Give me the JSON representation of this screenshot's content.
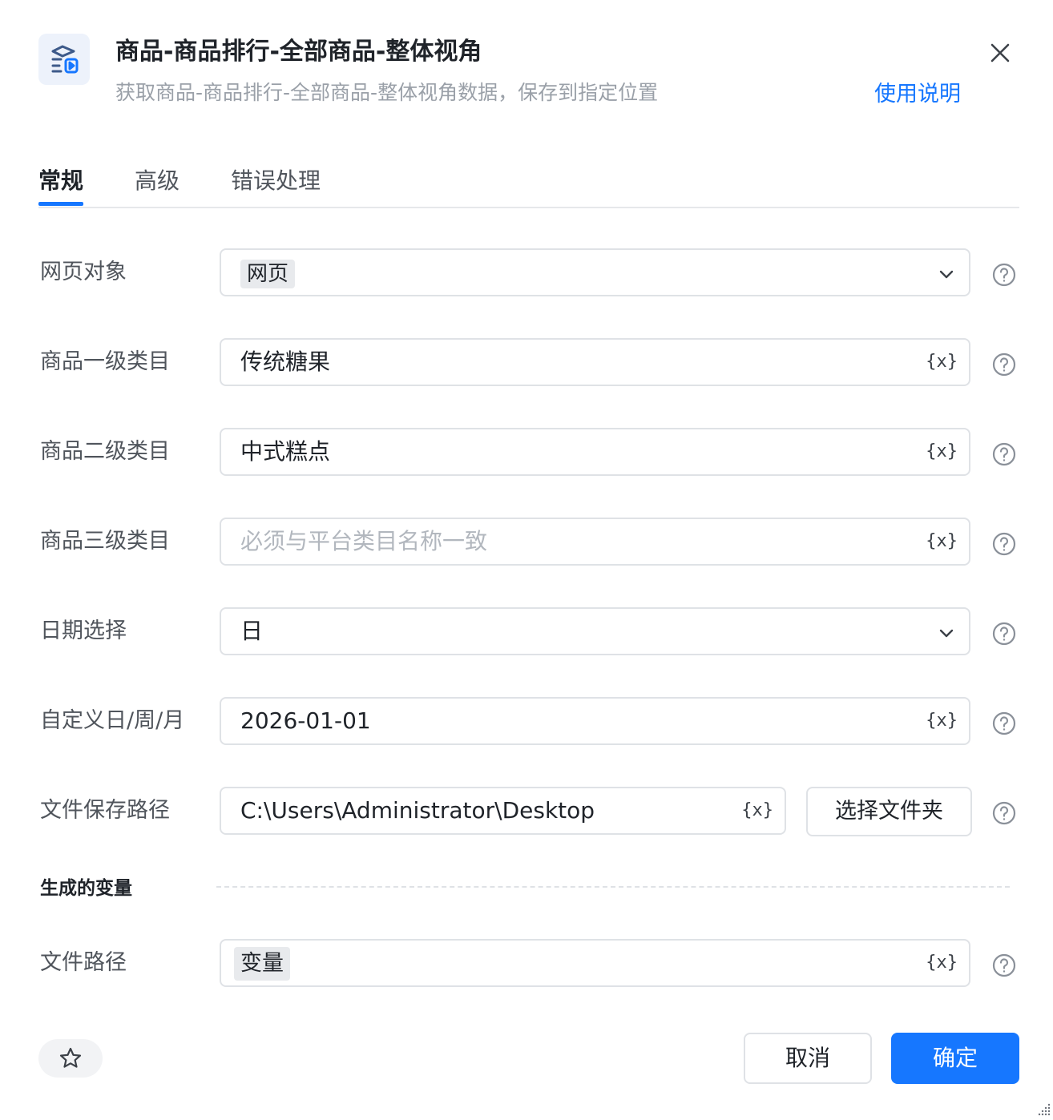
{
  "header": {
    "title": "商品-商品排行-全部商品-整体视角",
    "subtitle": "获取商品-商品排行-全部商品-整体视角数据，保存到指定位置",
    "help_link": "使用说明"
  },
  "tabs": [
    {
      "label": "常规",
      "active": true
    },
    {
      "label": "高级",
      "active": false
    },
    {
      "label": "错误处理",
      "active": false
    }
  ],
  "fields": {
    "web_object": {
      "label": "网页对象",
      "tag": "网页"
    },
    "category1": {
      "label": "商品一级类目",
      "value": "传统糖果"
    },
    "category2": {
      "label": "商品二级类目",
      "value": "中式糕点"
    },
    "category3": {
      "label": "商品三级类目",
      "placeholder": "必须与平台类目名称一致"
    },
    "date_select": {
      "label": "日期选择",
      "value": "日"
    },
    "custom_date": {
      "label": "自定义日/周/月",
      "value": "2026-01-01"
    },
    "save_path": {
      "label": "文件保存路径",
      "value": "C:\\Users\\Administrator\\Desktop",
      "button": "选择文件夹"
    }
  },
  "variables_section": {
    "title": "生成的变量",
    "file_path": {
      "label": "文件路径",
      "tag": "变量"
    }
  },
  "variable_icon_text": "{x}",
  "footer": {
    "cancel": "取消",
    "confirm": "确定"
  },
  "colors": {
    "accent": "#1677ff",
    "border": "#dfe2e6"
  },
  "icons": [
    "app-icon",
    "close-icon",
    "chevron-down-icon",
    "variable-icon",
    "help-icon",
    "star-icon",
    "resize-grip-icon"
  ]
}
